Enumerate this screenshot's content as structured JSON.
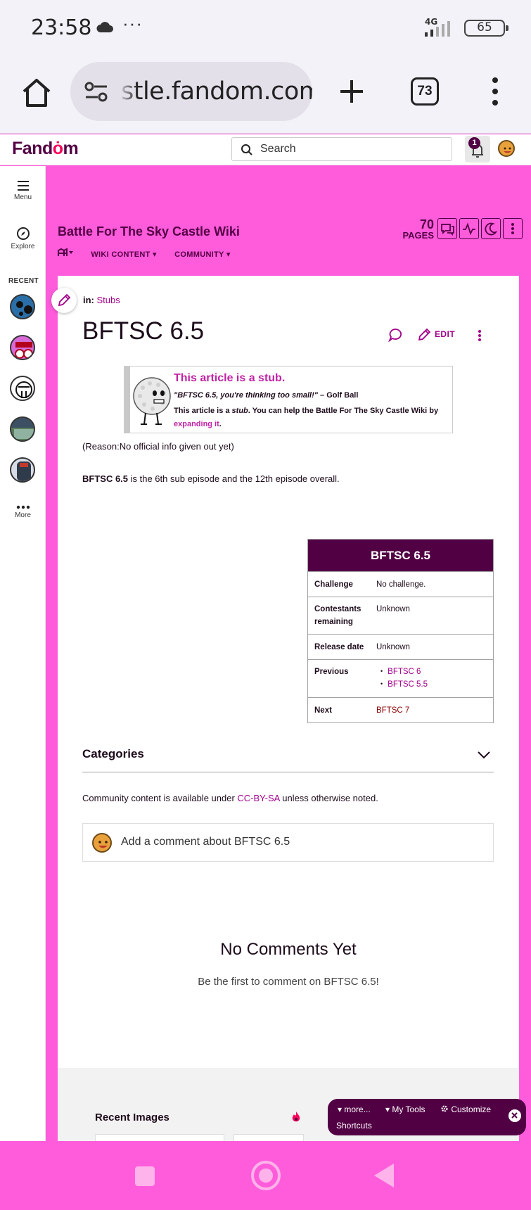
{
  "status_bar": {
    "time": "23:58",
    "dots": "···",
    "network": "4G",
    "battery": "65"
  },
  "browser": {
    "url": "stle.fandom.com",
    "tab_count": "73"
  },
  "fandom_bar": {
    "logo_before": "Fand",
    "logo_o": "ȯ",
    "logo_after": "m",
    "search_placeholder": "Search",
    "notification_count": "1"
  },
  "rail": {
    "menu_label": "Menu",
    "explore_label": "Explore",
    "recent_label": "RECENT",
    "more_label": "More"
  },
  "wiki": {
    "title": "Battle For The Sky Castle Wiki",
    "nav": [
      "WIKI CONTENT",
      "COMMUNITY"
    ],
    "pages_count": "70",
    "pages_label": "PAGES"
  },
  "article": {
    "in_label": "in:",
    "category": "Stubs",
    "title": "BFTSC 6.5",
    "edit_label": "EDIT",
    "stub": {
      "title": "This article is a stub.",
      "quote": "\"BFTSC 6.5, you're thinking too small!\"",
      "quote_author": " – Golf Ball",
      "body_before": "This article is a ",
      "body_stub": "stub",
      "body_middle": ". You can help the Battle For The Sky Castle Wiki by ",
      "body_link": "expanding it",
      "body_after": "."
    },
    "reason": "(Reason:No official info given out yet)",
    "intro_bold": "BFTSC 6.5",
    "intro_rest": " is the 6th sub episode and the 12th episode overall."
  },
  "infobox": {
    "title": "BFTSC 6.5",
    "challenge_label": "Challenge",
    "challenge_value": "No challenge.",
    "contestants_label_1": "Contestants",
    "contestants_label_2": "remaining",
    "contestants_value": "Unknown",
    "release_label": "Release date",
    "release_value": "Unknown",
    "previous_label": "Previous",
    "previous_values": [
      "BFTSC 6",
      "BFTSC 5.5"
    ],
    "next_label": "Next",
    "next_value": "BFTSC 7"
  },
  "categories_label": "Categories",
  "license": {
    "before": "Community content is available under ",
    "link": "CC-BY-SA",
    "after": " unless otherwise noted."
  },
  "comments": {
    "placeholder": "Add a comment about BFTSC 6.5",
    "empty_title": "No Comments Yet",
    "empty_sub": "Be the first to comment on BFTSC 6.5!"
  },
  "recent_images_label": "Recent Images",
  "toolbar": {
    "more": "more...",
    "my_tools": "My Tools",
    "customize": "Customize",
    "shortcuts": "Shortcuts"
  },
  "colors": {
    "accent": "#a2008a",
    "brand_dark": "#520044",
    "page_bg": "#ff5cdc"
  }
}
